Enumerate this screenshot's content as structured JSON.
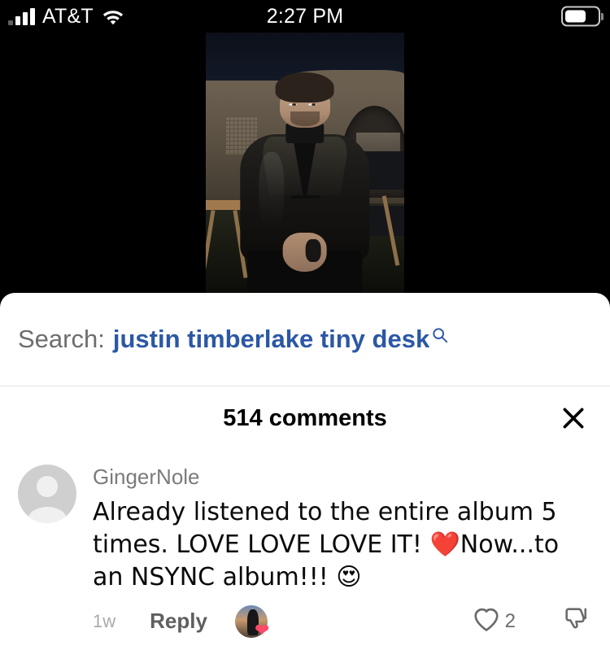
{
  "status_bar": {
    "carrier": "AT&T",
    "time": "2:27 PM",
    "signal_icon": "cellular-signal-icon",
    "wifi_icon": "wifi-icon",
    "battery_icon": "battery-icon",
    "battery_level_pct": 56
  },
  "video": {
    "description": "Man in black leather jacket and turtleneck seated in a director's chair outdoors at night",
    "background_color": "#000000"
  },
  "search": {
    "label": "Search:",
    "query": "justin timberlake tiny desk",
    "icon": "search-icon",
    "query_color": "#2b57a5",
    "label_color": "#6d6d6d"
  },
  "comments_header": {
    "title": "514 comments",
    "count": 514,
    "close_icon": "close-icon"
  },
  "comment": {
    "username": "GingerNole",
    "text": "Already listened to the entire album 5 times. LOVE LOVE LOVE IT! ❤️Now...to an NSYNC album!!! 😍",
    "avatar": "default-user-avatar",
    "timestamp": "1w",
    "reply_label": "Reply",
    "creator_liked_icon": "creator-heart-badge-icon",
    "creator_heart_color": "#fe4968",
    "like_icon": "heart-outline-icon",
    "like_count": "2",
    "dislike_icon": "thumbs-down-outline-icon"
  }
}
